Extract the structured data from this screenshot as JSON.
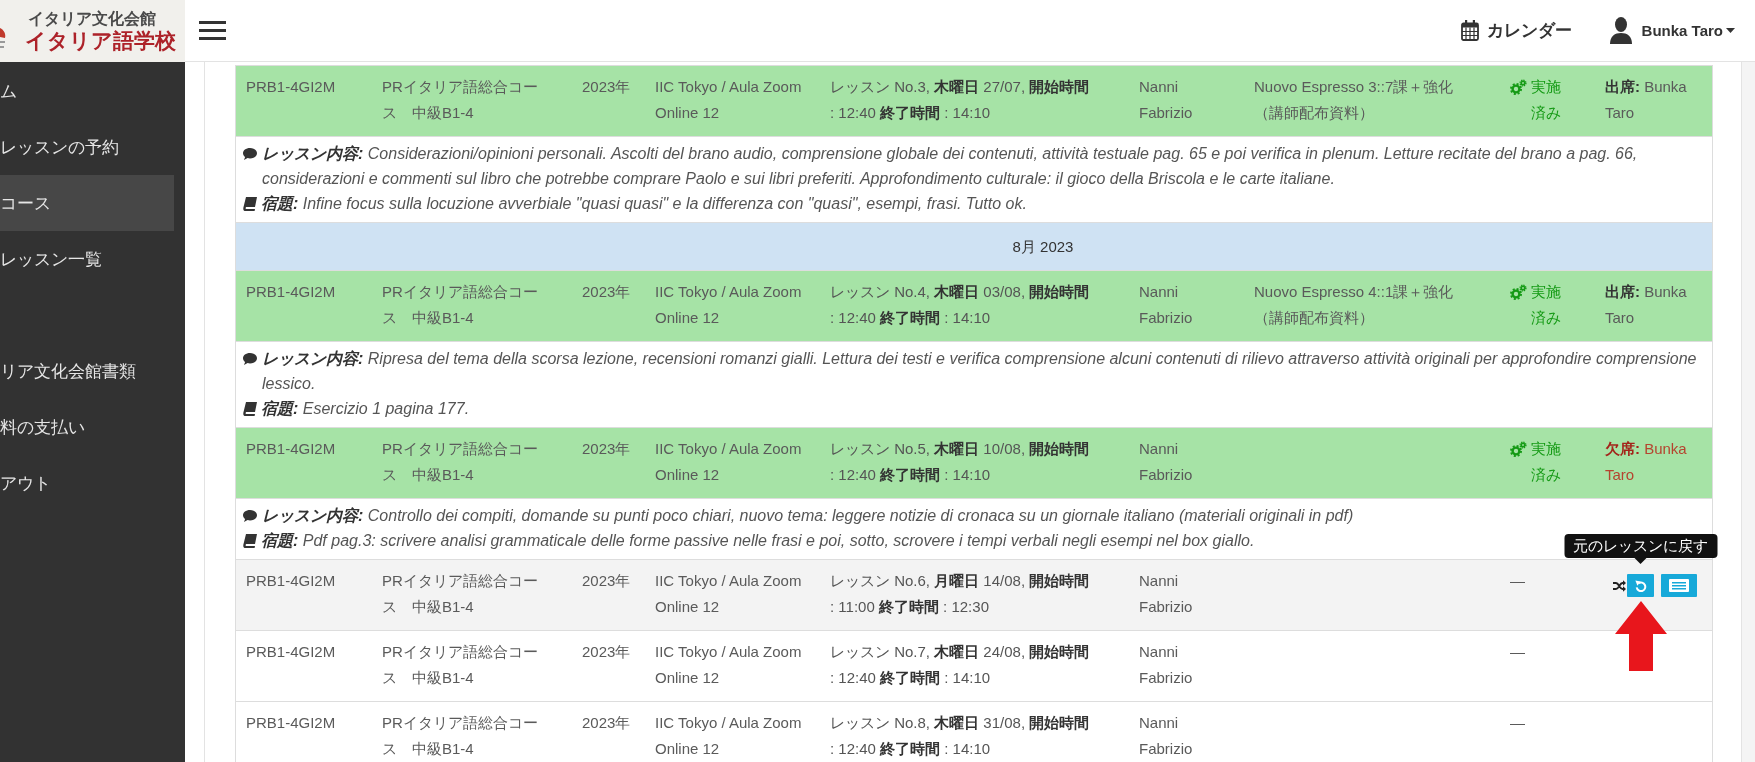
{
  "header": {
    "logo_subtitle": "イタリア文化会館",
    "logo_title": "イタリア語学校",
    "calendar_link": "カレンダー",
    "user_menu": "Bunka Taro"
  },
  "sidebar": {
    "sections": [
      {
        "items": [
          {
            "label": "ム",
            "selected": false
          },
          {
            "label": "レッスンの予約",
            "selected": false
          },
          {
            "label": "コース",
            "selected": true
          },
          {
            "label": "レッスン一覧",
            "selected": false
          }
        ]
      },
      {
        "items": [
          {
            "label": "リア文化会館書類",
            "selected": false
          },
          {
            "label": "料の支払い",
            "selected": false
          },
          {
            "label": "アウト",
            "selected": false
          }
        ]
      }
    ]
  },
  "rows": [
    {
      "kind": "lesson",
      "completed": true,
      "highlighted": false,
      "code": "PRB1-4GI2M",
      "course": "PRイタリア語総合コース　中級B1-4",
      "year": "2023年",
      "location": "IIC Tokyo / Aula Zoom Online 12",
      "schedule": [
        "レッスン No.3, **木曜日** 27/07, **開始時間**",
        ": 12:40 **終了時間** : 14:10"
      ],
      "teacher": "Nanni Fabrizio",
      "material": "Nuovo Espresso 3::7課＋強化（講師配布資料）",
      "status": "実施済み",
      "attendance": {
        "present": true,
        "text": "**出席:** Bunka Taro"
      }
    },
    {
      "kind": "details",
      "content": "**レッスン内容:** Considerazioni/opinioni personali. Ascolti del brano audio, comprensione globale dei contenuti, attività testuale pag. 65 e poi verifica in plenum. Letture recitate del brano a pag. 66, considerazioni e commenti sul libro che potrebbe comprare Paolo e sui libri preferiti. Approfondimento culturale: il gioco della Briscola e le carte italiane.",
      "homework": "**宿題:** Infine focus sulla locuzione avverbiale \"quasi quasi\" e la differenza con \"quasi\", esempi, frasi. Tutto ok."
    },
    {
      "kind": "month",
      "label": "8月 2023"
    },
    {
      "kind": "lesson",
      "completed": true,
      "highlighted": false,
      "code": "PRB1-4GI2M",
      "course": "PRイタリア語総合コース　中級B1-4",
      "year": "2023年",
      "location": "IIC Tokyo / Aula Zoom Online 12",
      "schedule": [
        "レッスン No.4, **木曜日** 03/08, **開始時間**",
        ": 12:40 **終了時間** : 14:10"
      ],
      "teacher": "Nanni Fabrizio",
      "material": "Nuovo Espresso 4::1課＋強化（講師配布資料）",
      "status": "実施済み",
      "attendance": {
        "present": true,
        "text": "**出席:** Bunka Taro"
      }
    },
    {
      "kind": "details",
      "content": "**レッスン内容:** Ripresa del tema della scorsa lezione, recensioni romanzi gialli. Lettura dei testi e verifica comprensione alcuni contenuti di rilievo attraverso attività originali per approfondire comprensione lessico.",
      "homework": "**宿題:** Esercizio 1 pagina 177."
    },
    {
      "kind": "lesson",
      "completed": true,
      "highlighted": false,
      "code": "PRB1-4GI2M",
      "course": "PRイタリア語総合コース　中級B1-4",
      "year": "2023年",
      "location": "IIC Tokyo / Aula Zoom Online 12",
      "schedule": [
        "レッスン No.5, **木曜日** 10/08, **開始時間**",
        ": 12:40 **終了時間** : 14:10"
      ],
      "teacher": "Nanni Fabrizio",
      "status": "実施済み",
      "attendance": {
        "present": false,
        "text": "**欠席:** Bunka Taro"
      }
    },
    {
      "kind": "details",
      "content": "**レッスン内容:** Controllo dei compiti, domande su punti poco chiari, nuovo tema: leggere notizie di cronaca su un giornale italiano (materiali originali in pdf)",
      "homework": "**宿題:** Pdf pag.3: scrivere analisi grammaticale delle forme passive nelle frasi e poi, sotto, scrovere i tempi verbali negli esempi nel box giallo."
    },
    {
      "kind": "lesson",
      "completed": false,
      "highlighted": true,
      "code": "PRB1-4GI2M",
      "course": "PRイタリア語総合コース　中級B1-4",
      "year": "2023年",
      "location": "IIC Tokyo / Aula Zoom Online 12",
      "schedule": [
        "レッスン No.6, **月曜日** 14/08, **開始時間**",
        ": 11:00 **終了時間** : 12:30"
      ],
      "teacher": "Nanni Fabrizio",
      "status": "—",
      "actions": {
        "tooltip": "元のレッスンに戻す",
        "annotated": true
      }
    },
    {
      "kind": "lesson",
      "completed": false,
      "code": "PRB1-4GI2M",
      "course": "PRイタリア語総合コース　中級B1-4",
      "year": "2023年",
      "location": "IIC Tokyo / Aula Zoom Online 12",
      "schedule": [
        "レッスン No.7, **木曜日** 24/08, **開始時間**",
        ": 12:40 **終了時間** : 14:10"
      ],
      "teacher": "Nanni Fabrizio",
      "status": "—"
    },
    {
      "kind": "lesson",
      "completed": false,
      "code": "PRB1-4GI2M",
      "course": "PRイタリア語総合コース　中級B1-4",
      "year": "2023年",
      "location": "IIC Tokyo / Aula Zoom Online 12",
      "schedule": [
        "レッスン No.8, **木曜日** 31/08, **開始時間**",
        ": 12:40 **終了時間** : 14:10"
      ],
      "teacher": "Nanni Fabrizio",
      "status": "—"
    }
  ]
}
